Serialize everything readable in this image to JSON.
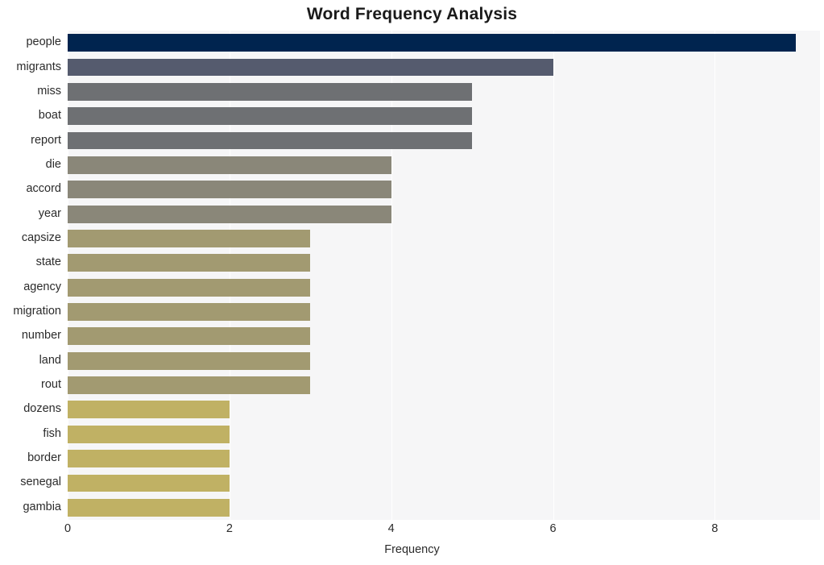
{
  "chart_data": {
    "type": "bar",
    "orientation": "horizontal",
    "title": "Word Frequency Analysis",
    "xlabel": "Frequency",
    "ylabel": "",
    "xlim": [
      0,
      9.3
    ],
    "xticks": [
      0,
      2,
      4,
      6,
      8
    ],
    "xtick_labels": [
      "0",
      "2",
      "4",
      "6",
      "8"
    ],
    "grid": "vertical",
    "legend": "none",
    "categories": [
      "people",
      "migrants",
      "miss",
      "boat",
      "report",
      "die",
      "accord",
      "year",
      "capsize",
      "state",
      "agency",
      "migration",
      "number",
      "land",
      "rout",
      "dozens",
      "fish",
      "border",
      "senegal",
      "gambia"
    ],
    "values": [
      9,
      6,
      5,
      5,
      5,
      4,
      4,
      4,
      3,
      3,
      3,
      3,
      3,
      3,
      3,
      2,
      2,
      2,
      2,
      2
    ],
    "bar_colors": [
      "#00244f",
      "#555b6e",
      "#6e7073",
      "#6e7073",
      "#6e7073",
      "#8a8779",
      "#8a8779",
      "#8a8779",
      "#a29a71",
      "#a29a71",
      "#a29a71",
      "#a29a71",
      "#a29a71",
      "#a29a71",
      "#a29a71",
      "#c0b164",
      "#c0b164",
      "#c0b164",
      "#c0b164",
      "#c0b164"
    ],
    "plot_background": "#f6f6f7",
    "gridline_color": "#ffffff",
    "figure_background": "#ffffff",
    "title_color": "#1a1a1a",
    "tick_color": "#2b2b2b"
  }
}
